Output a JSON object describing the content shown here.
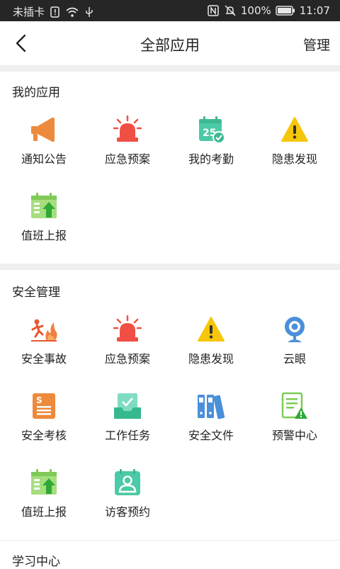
{
  "status_bar": {
    "carrier": "未插卡",
    "battery": "100%",
    "time": "11:07"
  },
  "header": {
    "title": "全部应用",
    "manage": "管理"
  },
  "sections": [
    {
      "title": "我的应用",
      "apps": [
        {
          "label": "通知公告",
          "icon": "megaphone-icon"
        },
        {
          "label": "应急预案",
          "icon": "alarm-light-icon"
        },
        {
          "label": "我的考勤",
          "icon": "calendar-check-icon"
        },
        {
          "label": "隐患发现",
          "icon": "warning-triangle-icon"
        },
        {
          "label": "值班上报",
          "icon": "calendar-upload-icon"
        }
      ]
    },
    {
      "title": "安全管理",
      "apps": [
        {
          "label": "安全事故",
          "icon": "fire-accident-icon"
        },
        {
          "label": "应急预案",
          "icon": "alarm-light-icon"
        },
        {
          "label": "隐患发现",
          "icon": "warning-triangle-icon"
        },
        {
          "label": "云眼",
          "icon": "webcam-icon"
        },
        {
          "label": "安全考核",
          "icon": "assessment-doc-icon"
        },
        {
          "label": "工作任务",
          "icon": "task-tray-icon"
        },
        {
          "label": "安全文件",
          "icon": "binders-icon"
        },
        {
          "label": "预警中心",
          "icon": "doc-warning-icon"
        },
        {
          "label": "值班上报",
          "icon": "calendar-upload-icon"
        },
        {
          "label": "访客预约",
          "icon": "visitor-icon"
        }
      ]
    },
    {
      "title": "学习中心",
      "apps": []
    }
  ],
  "colors": {
    "orange": "#ee8a3c",
    "red": "#f04f43",
    "teal": "#4cc9a6",
    "yellow": "#f6c60a",
    "green": "#8bd36a",
    "blue": "#4a90d9"
  }
}
